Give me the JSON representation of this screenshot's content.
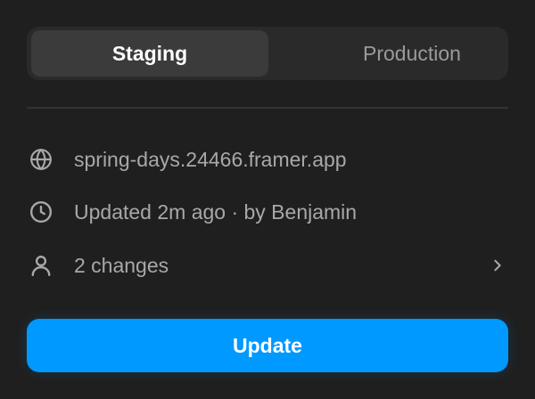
{
  "segmented": {
    "options": [
      {
        "label": "Staging",
        "selected": true
      },
      {
        "label": "Production",
        "selected": false
      }
    ]
  },
  "info": {
    "url": {
      "icon": "globe-icon",
      "text": "spring-days.24466.framer.app"
    },
    "updated": {
      "icon": "clock-icon",
      "text": "Updated 2m ago · by Benjamin"
    },
    "changes": {
      "icon": "person-icon",
      "text": "2 changes",
      "chevron": "chevron-right-icon"
    }
  },
  "actions": {
    "update_label": "Update"
  },
  "colors": {
    "background": "#1f1f1f",
    "segmented_bg": "#2a2a2a",
    "segment_active": "#3b3b3b",
    "text_muted": "#a8a8a8",
    "accent": "#0099ff"
  }
}
